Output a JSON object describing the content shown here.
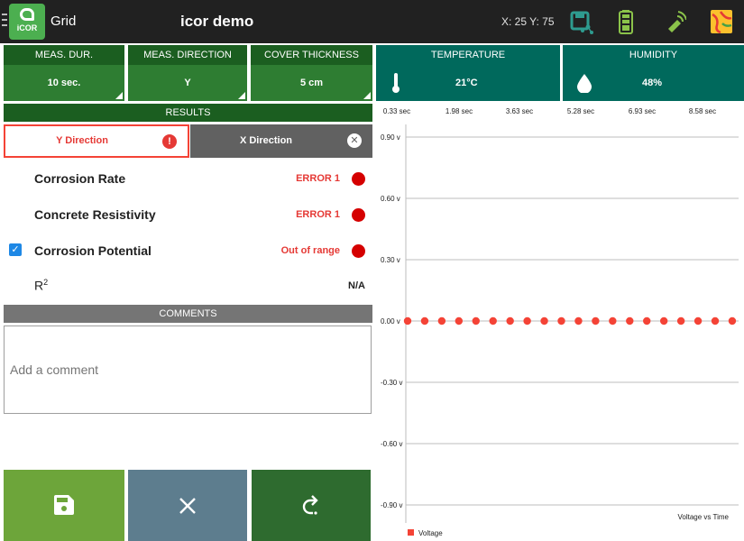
{
  "topbar": {
    "app_title": "Grid",
    "logo_text": "iCOR",
    "project_title": "icor demo",
    "coords": "X: 25 Y: 75",
    "icons": [
      "menu-icon",
      "export-icon",
      "battery-icon",
      "wireless-icon",
      "map-icon"
    ]
  },
  "settings": [
    {
      "header": "MEAS. DUR.",
      "value": "10 sec."
    },
    {
      "header": "MEAS. DIRECTION",
      "value": "Y"
    },
    {
      "header": "COVER THICKNESS",
      "value": "5 cm"
    }
  ],
  "environment": [
    {
      "header": "TEMPERATURE",
      "value": "21°C",
      "icon": "thermometer-icon"
    },
    {
      "header": "HUMIDITY",
      "value": "48%",
      "icon": "water-drop-icon"
    }
  ],
  "results": {
    "header": "RESULTS",
    "tabs": [
      {
        "label": "Y Direction",
        "icon": "error-icon",
        "active": true
      },
      {
        "label": "X Direction",
        "icon": "close-circle-icon",
        "active": false
      }
    ],
    "rows": [
      {
        "label": "Corrosion Rate",
        "status": "ERROR 1",
        "checked": false
      },
      {
        "label": "Concrete Resistivity",
        "status": "ERROR 1",
        "checked": false
      },
      {
        "label": "Corrosion Potential",
        "status": "Out of range",
        "checked": true
      }
    ],
    "r2_label": "R",
    "r2_sup": "2",
    "r2_value": "N/A"
  },
  "comments": {
    "header": "COMMENTS",
    "placeholder": "Add a comment",
    "value": ""
  },
  "actions": [
    {
      "name": "save-button",
      "icon": "floppy-disk-icon",
      "color": "#6da53a"
    },
    {
      "name": "cancel-button",
      "icon": "close-icon",
      "color": "#5d7d8e"
    },
    {
      "name": "redo-button",
      "icon": "redo-icon",
      "color": "#2e6b2f"
    }
  ],
  "colors": {
    "error": "#e53935",
    "series": "#f44336",
    "dark_green": "#1b5e20",
    "teal": "#00695c"
  },
  "chart_data": {
    "type": "scatter",
    "title": "Voltage vs Time",
    "x_ticks": [
      "0.33 sec",
      "1.98 sec",
      "3.63 sec",
      "5.28 sec",
      "6.93 sec",
      "8.58 sec"
    ],
    "y_ticks": [
      "0.90 v",
      "0.60 v",
      "0.30 v",
      "0.00 v",
      "-0.30 v",
      "-0.60 v",
      "-0.90 v"
    ],
    "y_tick_values": [
      0.9,
      0.6,
      0.3,
      0.0,
      -0.3,
      -0.6,
      -0.9
    ],
    "ylim": [
      -0.9,
      0.9
    ],
    "xlim": [
      0.33,
      9.0
    ],
    "grid": true,
    "legend": "bottom-left",
    "series": [
      {
        "name": "Voltage",
        "color": "#f44336",
        "x": [
          0.33,
          0.78,
          1.23,
          1.68,
          2.13,
          2.58,
          3.03,
          3.48,
          3.93,
          4.38,
          4.83,
          5.28,
          5.73,
          6.18,
          6.63,
          7.08,
          7.53,
          7.98,
          8.43,
          8.88
        ],
        "y": [
          0,
          0,
          0,
          0,
          0,
          0,
          0,
          0,
          0,
          0,
          0,
          0,
          0,
          0,
          0,
          0,
          0,
          0,
          0,
          0
        ]
      }
    ]
  }
}
